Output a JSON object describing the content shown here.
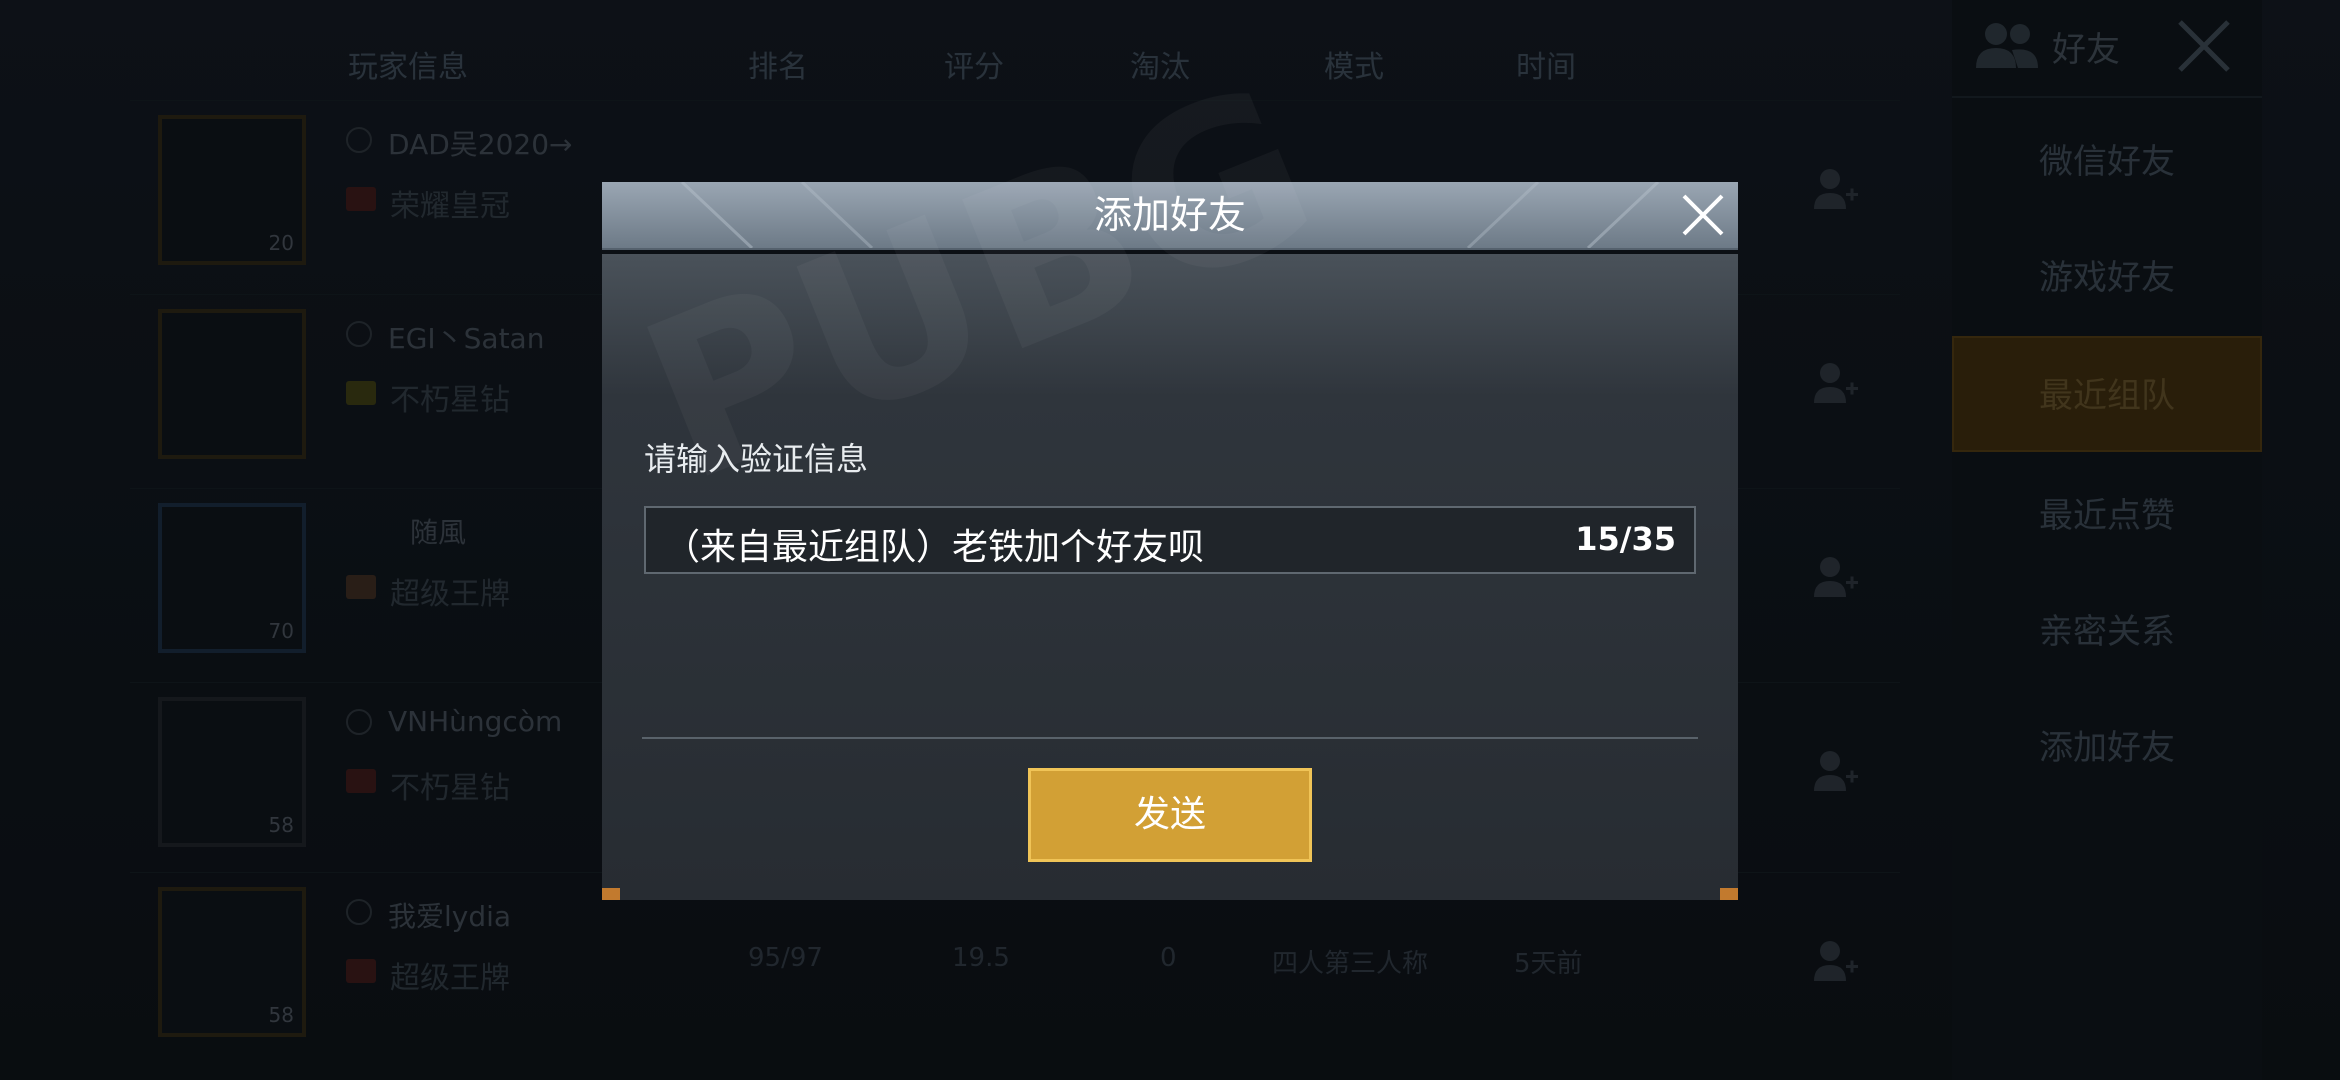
{
  "table": {
    "headers": [
      "玩家信息",
      "排名",
      "评分",
      "淘汰",
      "模式",
      "时间"
    ],
    "rows": [
      {
        "name": "DAD吴2020→",
        "rank": "荣耀皇冠",
        "level": "20",
        "r": "",
        "s": "",
        "e": "",
        "m": "",
        "t": ""
      },
      {
        "name": "EGI丶Satan",
        "rank": "不朽星钻",
        "level": "",
        "r": "",
        "s": "",
        "e": "",
        "m": "",
        "t": ""
      },
      {
        "name": "随風",
        "rank": "超级王牌",
        "level": "70",
        "r": "",
        "s": "",
        "e": "",
        "m": "",
        "t": ""
      },
      {
        "name": "VNHùngcòm",
        "rank": "不朽星钻",
        "level": "58",
        "r": "",
        "s": "",
        "e": "",
        "m": "",
        "t": ""
      },
      {
        "name": "我爱lydia",
        "rank": "超级王牌",
        "level": "58",
        "r": "95/97",
        "s": "19.5",
        "e": "0",
        "m": "四人第三人称",
        "t": "5天前"
      }
    ]
  },
  "sidebar": {
    "title": "好友",
    "items": [
      {
        "label": "微信好友",
        "active": false
      },
      {
        "label": "游戏好友",
        "active": false
      },
      {
        "label": "最近组队",
        "active": true
      },
      {
        "label": "最近点赞",
        "active": false
      },
      {
        "label": "亲密关系",
        "active": false
      },
      {
        "label": "添加好友",
        "active": false
      }
    ]
  },
  "dialog": {
    "title": "添加好友",
    "prompt": "请输入验证信息",
    "input_value": "（来自最近组队）老铁加个好友呗",
    "counter": "15/35",
    "send_label": "发送"
  },
  "colors": {
    "accent": "#d2a035",
    "accent_border": "#f0c457",
    "header": "#8895a2"
  }
}
